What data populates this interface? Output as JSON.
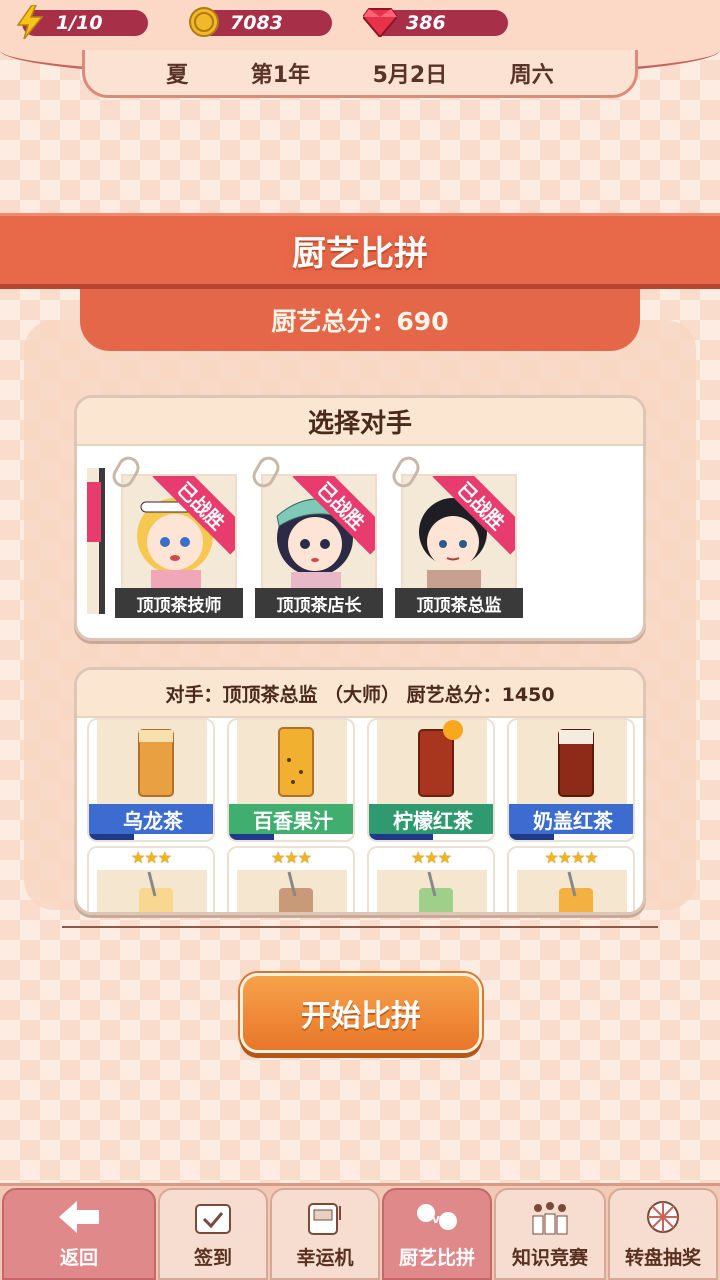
{
  "resources": {
    "energy": "1/10",
    "coins": "7083",
    "gems": "386"
  },
  "date": {
    "season": "夏",
    "year": "第1年",
    "day": "5月2日",
    "weekday": "周六"
  },
  "banner_title": "厨艺比拼",
  "score_text": "厨艺总分：690",
  "select": {
    "title": "选择对手",
    "opponents": [
      {
        "name": "顶顶茶技师",
        "status": "已战胜"
      },
      {
        "name": "顶顶茶店长",
        "status": "已战胜"
      },
      {
        "name": "顶顶茶总监",
        "status": "已战胜"
      }
    ]
  },
  "opponent_info": "对手：顶顶茶总监 （大师） 厨艺总分：1450",
  "drinks": [
    {
      "name": "乌龙茶",
      "color": "#3c6ccf",
      "progress": 0.35,
      "stars": "★★★"
    },
    {
      "name": "百香果汁",
      "color": "#3fae6e",
      "progress": 0.35,
      "stars": "★★★"
    },
    {
      "name": "柠檬红茶",
      "color": "#2f9a70",
      "progress": 0.5,
      "stars": "★★★"
    },
    {
      "name": "奶盖红茶",
      "color": "#3c6ccf",
      "progress": 0.35,
      "stars": "★★★★"
    }
  ],
  "start_button": "开始比拼",
  "nav": [
    "返回",
    "签到",
    "幸运机",
    "厨艺比拼",
    "知识竞赛",
    "转盘抽奖"
  ]
}
